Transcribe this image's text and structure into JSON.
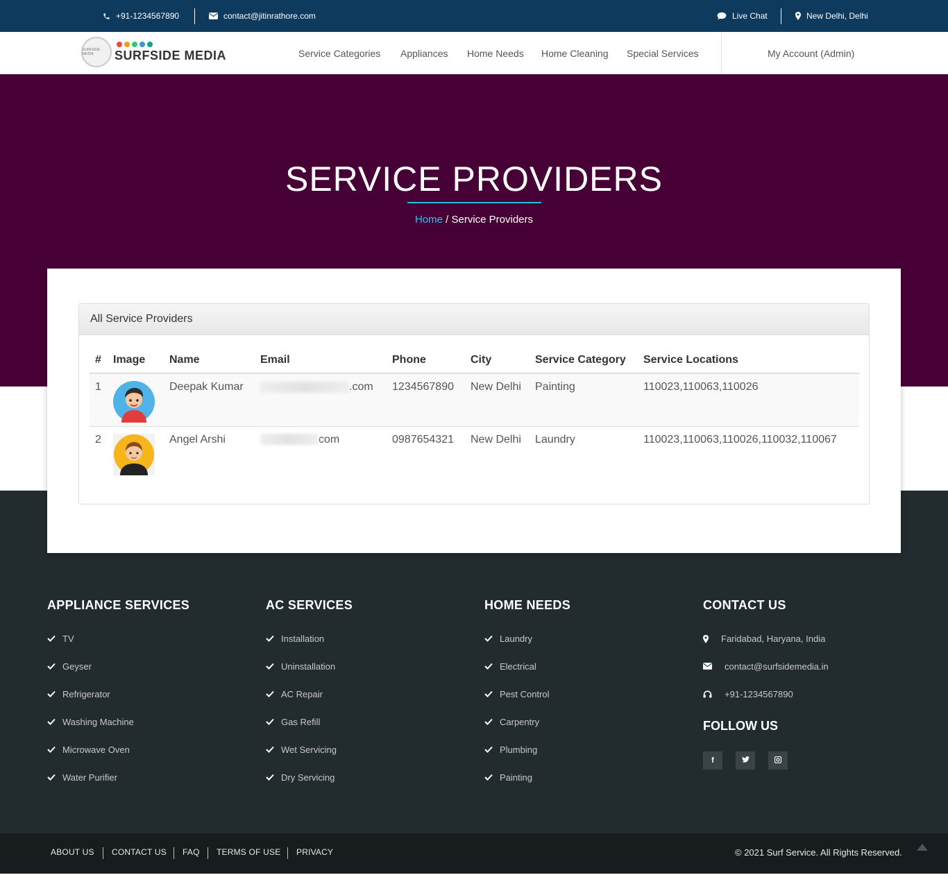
{
  "topbar": {
    "phone": "+91-1234567890",
    "email": "contact@jitinrathore.com",
    "live_chat": "Live Chat",
    "location": "New Delhi, Delhi"
  },
  "nav": {
    "logo_text": "SURFSIDE MEDIA",
    "logo_badge": "SURFSIDE MEDIA",
    "items": [
      "Service Categories",
      "Appliances",
      "Home Needs",
      "Home Cleaning",
      "Special Services"
    ],
    "account": "My Account (Admin)"
  },
  "hero": {
    "title": "SERVICE PROVIDERS",
    "breadcrumb_home": "Home",
    "breadcrumb_sep": " / ",
    "breadcrumb_current": "Service Providers"
  },
  "panel": {
    "title": "All Service Providers",
    "columns": [
      "#",
      "Image",
      "Name",
      "Email",
      "Phone",
      "City",
      "Service Category",
      "Service Locations"
    ],
    "rows": [
      {
        "num": "1",
        "name": "Deepak Kumar",
        "email_suffix": ".com",
        "phone": "1234567890",
        "city": "New Delhi",
        "category": "Painting",
        "locations": "110023,110063,110026"
      },
      {
        "num": "2",
        "name": "Angel Arshi",
        "email_suffix": "com",
        "phone": "0987654321",
        "city": "New Delhi",
        "category": "Laundry",
        "locations": "110023,110063,110026,110032,110067"
      }
    ]
  },
  "footer": {
    "appliance": {
      "title": "APPLIANCE SERVICES",
      "items": [
        "TV",
        "Geyser",
        "Refrigerator",
        "Washing Machine",
        "Microwave Oven",
        "Water Purifier"
      ]
    },
    "ac": {
      "title": "AC SERVICES",
      "items": [
        "Installation",
        "Uninstallation",
        "AC Repair",
        "Gas Refill",
        "Wet Servicing",
        "Dry Servicing"
      ]
    },
    "home": {
      "title": "HOME NEEDS",
      "items": [
        "Laundry",
        "Electrical",
        "Pest Control",
        "Carpentry",
        "Plumbing",
        "Painting"
      ]
    },
    "contact": {
      "title": "CONTACT US",
      "address": "Faridabad, Haryana, India",
      "email": "contact@surfsidemedia.in",
      "phone": "+91-1234567890"
    },
    "follow": "FOLLOW US",
    "social": [
      "f",
      "t",
      "i"
    ]
  },
  "bottom": {
    "links": [
      "ABOUT US",
      "CONTACT US",
      "FAQ",
      "TERMS OF USE",
      "PRIVACY"
    ],
    "copyright": "© 2021 Surf Service. All Rights Reserved."
  },
  "colors": {
    "topbar": "#0e3a5e",
    "hero": "#470035",
    "accent": "#1fc2e2",
    "footer": "#222b2e",
    "bottom": "#171d1f"
  }
}
